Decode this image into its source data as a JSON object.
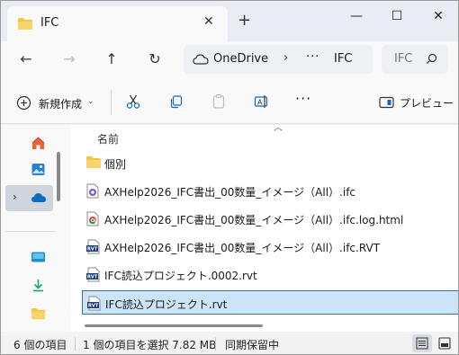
{
  "tab": {
    "title": "IFC",
    "close": "✕",
    "new_tab": "+"
  },
  "window_controls": {
    "minimize": "—",
    "maximize": "☐",
    "close": "✕"
  },
  "nav": {
    "back": "←",
    "forward": "→",
    "up": "↑",
    "refresh": "↻"
  },
  "address": {
    "root": "OneDrive",
    "separator": "›",
    "ellipsis": "···",
    "current": "IFC"
  },
  "search": {
    "placeholder": "IFC"
  },
  "toolbar": {
    "new_label": "新規作成",
    "new_caret": "⌄",
    "more": "···",
    "preview_label": "プレビュー"
  },
  "nav_pane": {
    "expand_chevron": "›"
  },
  "file_list": {
    "sort_caret": "︿",
    "column_name": "名前",
    "items": [
      {
        "name": "個別",
        "icon": "folder-icon"
      },
      {
        "name": "AXHelp2026_IFC書出_00数量_イメージ（All）.ifc",
        "icon": "ifc-file-icon"
      },
      {
        "name": "AXHelp2026_IFC書出_00数量_イメージ（All）.ifc.log.html",
        "icon": "chrome-html-icon"
      },
      {
        "name": "AXHelp2026_IFC書出_00数量_イメージ（All）.ifc.RVT",
        "icon": "rvt-file-icon"
      },
      {
        "name": "IFC読込プロジェクト.0002.rvt",
        "icon": "rvt-file-icon"
      },
      {
        "name": "IFC読込プロジェクト.rvt",
        "icon": "rvt-file-icon",
        "selected": true
      }
    ]
  },
  "status": {
    "item_count": "6 個の項目",
    "selection": "1 個の項目を選択  7.82 MB",
    "sync": "同期保留中"
  },
  "colors": {
    "folder": "#f4c542",
    "onedrive": "#0f6cbd",
    "selection": "#cce4f7",
    "accent": "#2f6fad"
  }
}
